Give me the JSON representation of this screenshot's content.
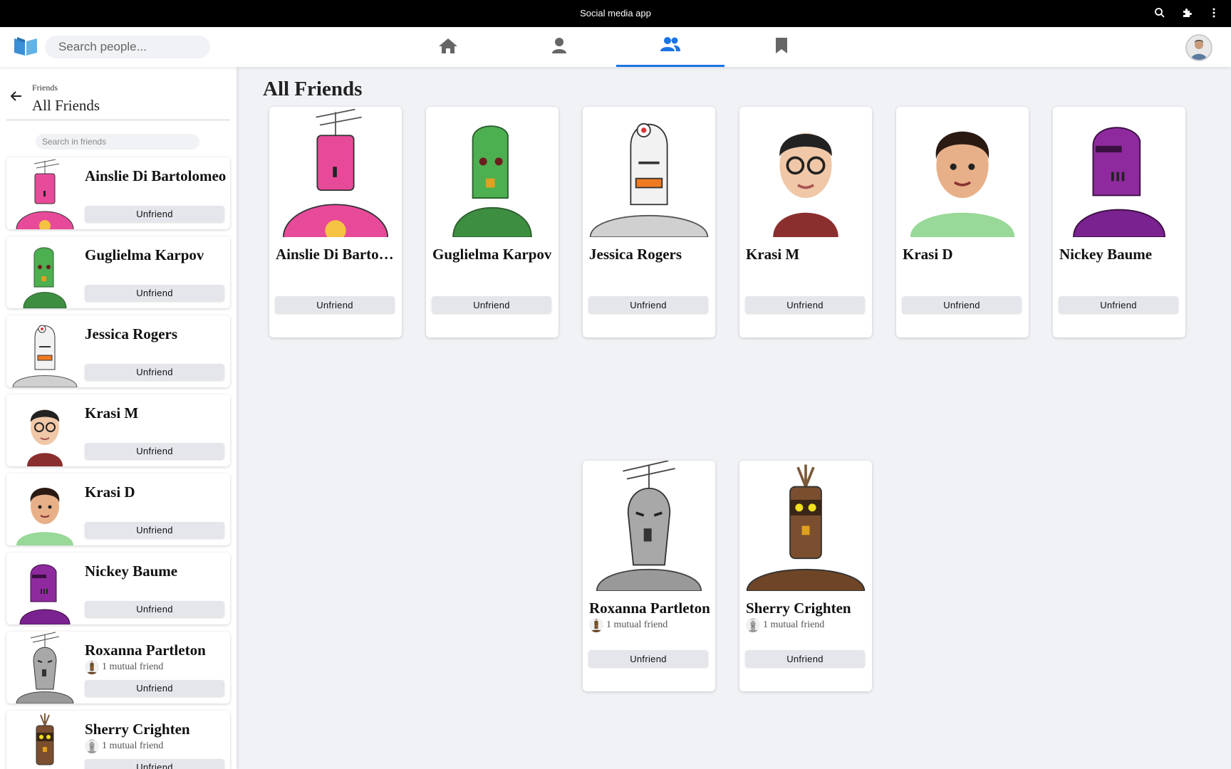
{
  "window": {
    "title": "Social media app",
    "icons": [
      "search-icon",
      "extension-icon",
      "more-vert-icon"
    ]
  },
  "topnav": {
    "search_placeholder": "Search people...",
    "tabs": [
      {
        "name": "home",
        "icon": "home-icon",
        "active": false
      },
      {
        "name": "profile",
        "icon": "person-icon",
        "active": false
      },
      {
        "name": "friends",
        "icon": "people-icon",
        "active": true
      },
      {
        "name": "saved",
        "icon": "bookmark-icon",
        "active": false
      }
    ],
    "accent": "#1b74e4"
  },
  "sidebar": {
    "breadcrumb": "Friends",
    "title": "All Friends",
    "search_placeholder": "Search in friends",
    "friends": [
      {
        "name": "Ainslie Di Bartolomeo",
        "mutual": "",
        "avatar": "pink-robot",
        "button": "Unfriend"
      },
      {
        "name": "Guglielma Karpov",
        "mutual": "",
        "avatar": "green-robot",
        "button": "Unfriend"
      },
      {
        "name": "Jessica Rogers",
        "mutual": "",
        "avatar": "white-robot",
        "button": "Unfriend"
      },
      {
        "name": "Krasi M",
        "mutual": "",
        "avatar": "man-glasses",
        "button": "Unfriend"
      },
      {
        "name": "Krasi D",
        "mutual": "",
        "avatar": "man-green-shirt",
        "button": "Unfriend"
      },
      {
        "name": "Nickey Baume",
        "mutual": "",
        "avatar": "purple-robot",
        "button": "Unfriend"
      },
      {
        "name": "Roxanna Partleton",
        "mutual": "1 mutual friend",
        "avatar": "grey-robot",
        "button": "Unfriend"
      },
      {
        "name": "Sherry Crighten",
        "mutual": "1 mutual friend",
        "avatar": "brown-robot",
        "button": "Unfriend"
      }
    ]
  },
  "main": {
    "title": "All Friends",
    "cards": [
      {
        "name": "Ainslie Di Bartolomeo",
        "mutual": "",
        "avatar": "pink-robot",
        "button": "Unfriend"
      },
      {
        "name": "Guglielma Karpov",
        "mutual": "",
        "avatar": "green-robot",
        "button": "Unfriend"
      },
      {
        "name": "Jessica Rogers",
        "mutual": "",
        "avatar": "white-robot",
        "button": "Unfriend"
      },
      {
        "name": "Krasi M",
        "mutual": "",
        "avatar": "man-glasses",
        "button": "Unfriend"
      },
      {
        "name": "Krasi D",
        "mutual": "",
        "avatar": "man-green-shirt",
        "button": "Unfriend"
      },
      {
        "name": "Nickey Baume",
        "mutual": "",
        "avatar": "purple-robot",
        "button": "Unfriend"
      },
      {
        "name": "Roxanna Partleton",
        "mutual": "1 mutual friend",
        "avatar": "grey-robot",
        "button": "Unfriend"
      },
      {
        "name": "Sherry Crighten",
        "mutual": "1 mutual friend",
        "avatar": "brown-robot",
        "button": "Unfriend"
      }
    ]
  }
}
